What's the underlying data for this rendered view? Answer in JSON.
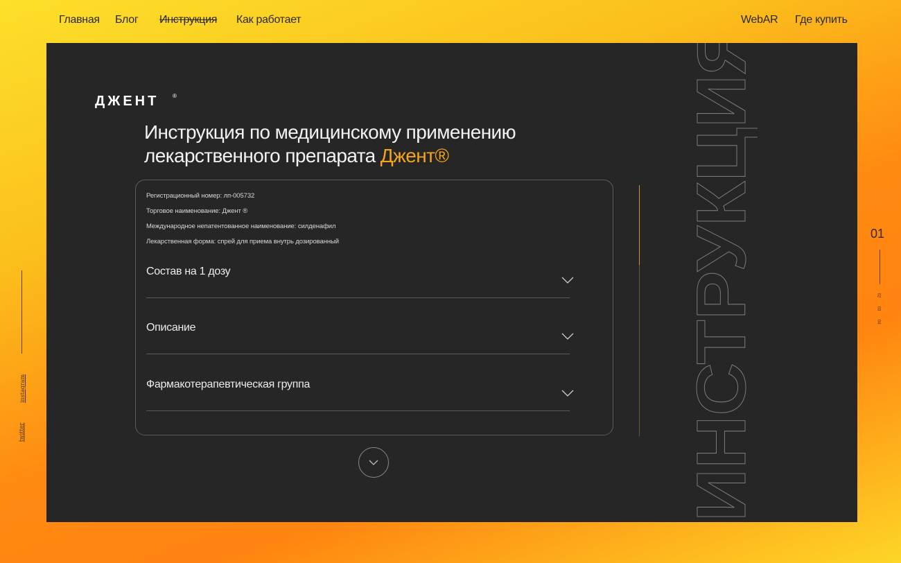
{
  "nav": {
    "left": [
      "Главная",
      "Блог",
      "Инструкция",
      "Как работает"
    ],
    "right": [
      "WebAR",
      "Где купить"
    ]
  },
  "brand": {
    "logo_text": "ДЖЕНТ"
  },
  "headline": {
    "line1": "Инструкция по медицинскому применению",
    "line2_prefix": "лекарственного препарата ",
    "line2_accent": "Джент®"
  },
  "info": [
    "Регистрационный номер: лп-005732",
    "Торговое наименование: Джент ®",
    "Международное непатентованное наименование: силденафил",
    "Лекарственная форма: спрей для приема внутрь дозированный"
  ],
  "accordion": [
    {
      "label": "Состав на 1 дозу"
    },
    {
      "label": "Описание"
    },
    {
      "label": "Фармакотерапевтическая группа"
    }
  ],
  "big_word": "ИНСТРУКЦИЯ",
  "social": [
    "instagram",
    "twitter"
  ],
  "pager": {
    "current": "01",
    "others": [
      "02",
      "03",
      "04"
    ]
  },
  "colors": {
    "accent": "#f5a41b",
    "panel": "#262626",
    "outline": "#8a8a8a"
  }
}
